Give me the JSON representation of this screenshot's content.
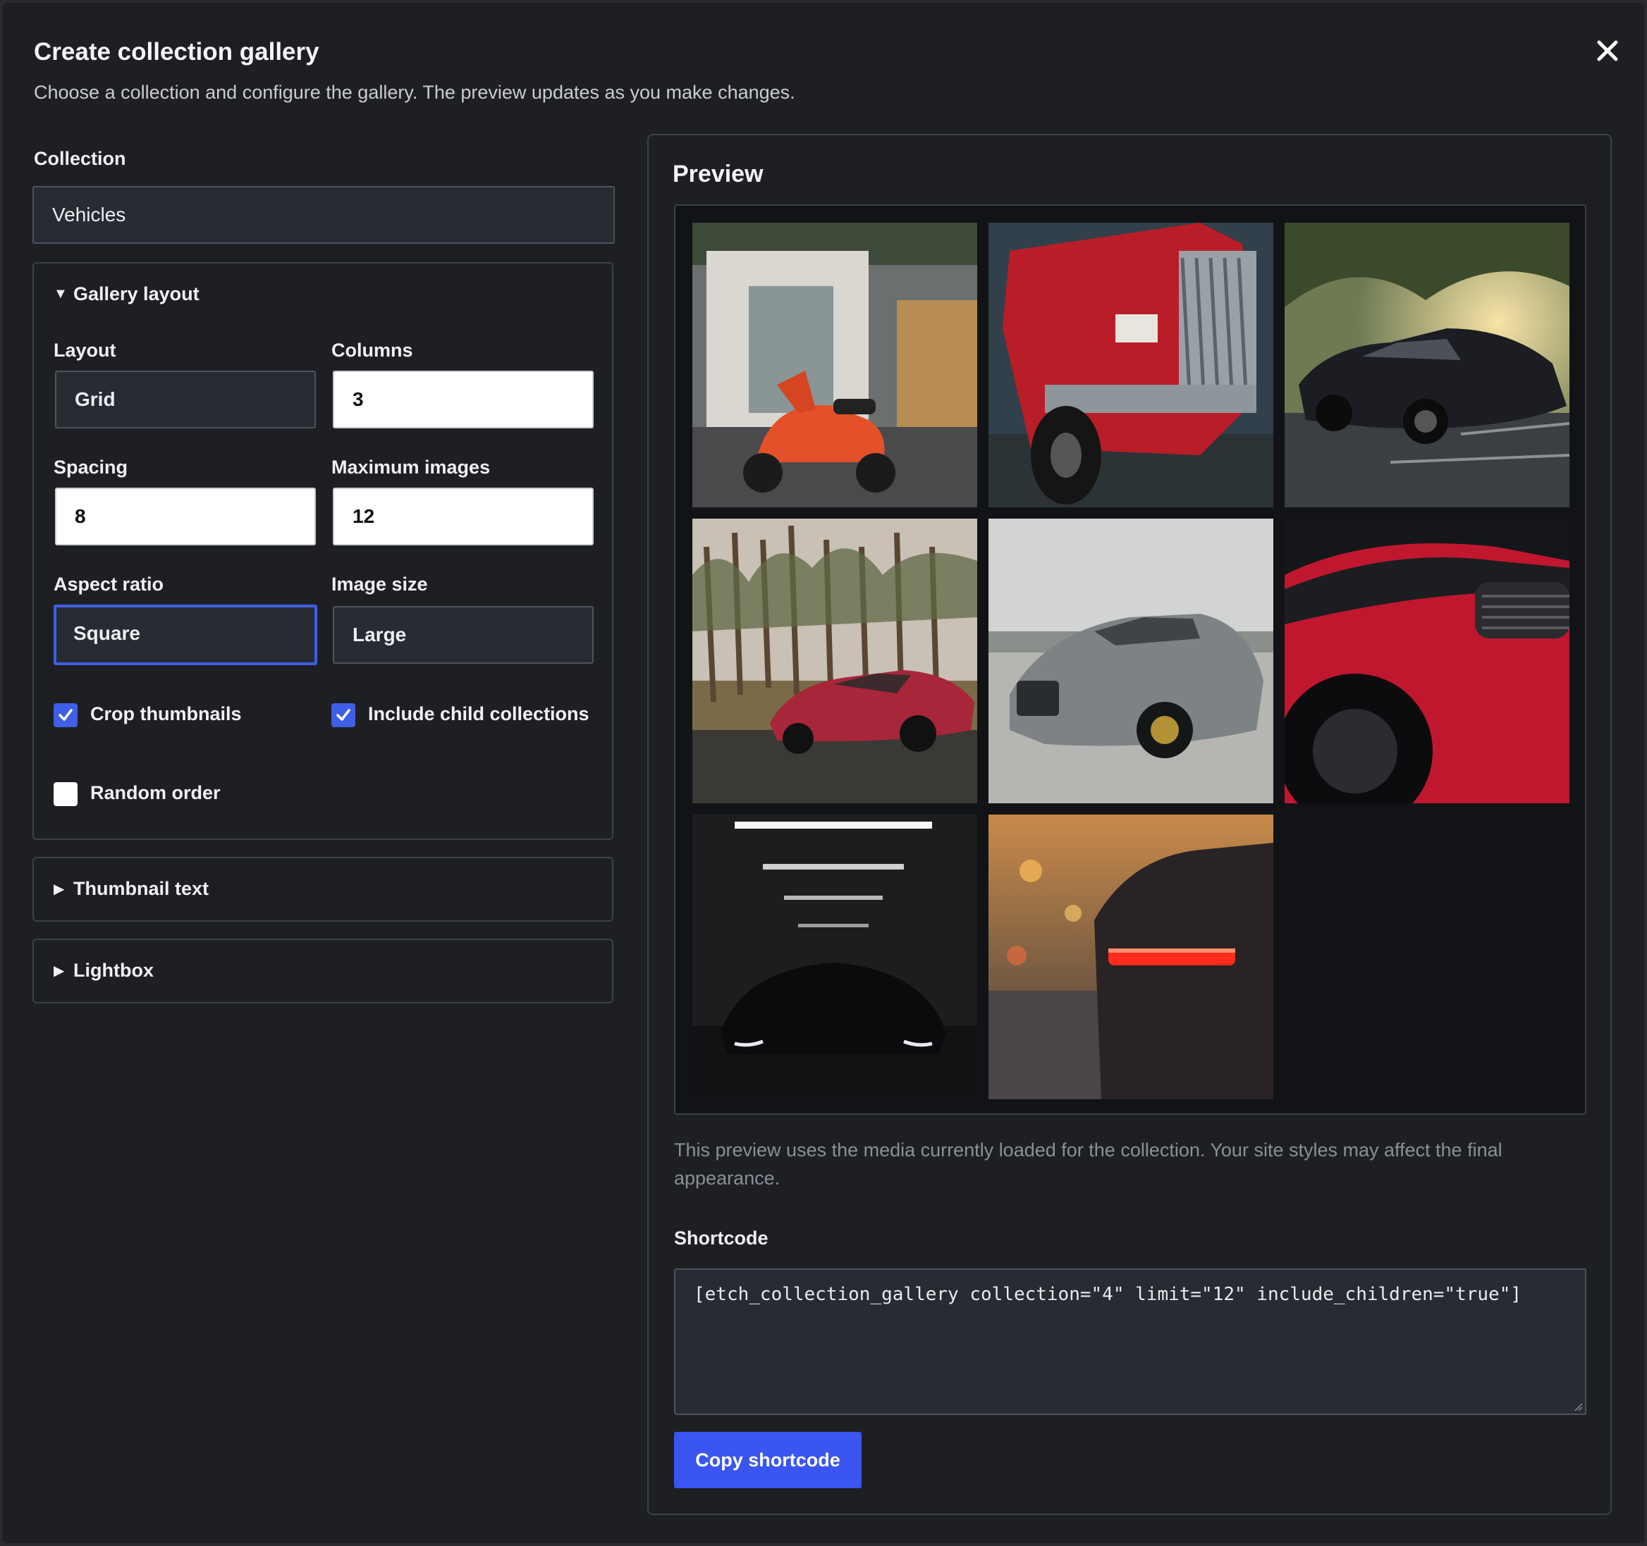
{
  "modal": {
    "title": "Create collection gallery",
    "description": "Choose a collection and configure the gallery. The preview updates as you make changes."
  },
  "collection": {
    "label": "Collection",
    "value": "Vehicles"
  },
  "gallery_layout": {
    "summary": "Gallery layout",
    "expanded": true,
    "layout": {
      "label": "Layout",
      "value": "Grid"
    },
    "columns": {
      "label": "Columns",
      "value": "3"
    },
    "spacing": {
      "label": "Spacing",
      "value": "8"
    },
    "max_images": {
      "label": "Maximum images",
      "value": "12"
    },
    "aspect_ratio": {
      "label": "Aspect ratio",
      "value": "Square"
    },
    "image_size": {
      "label": "Image size",
      "value": "Large"
    },
    "crop_thumbnails": {
      "label": "Crop thumbnails",
      "checked": true
    },
    "include_children": {
      "label": "Include child collections",
      "checked": true
    },
    "random_order": {
      "label": "Random order",
      "checked": false
    }
  },
  "thumbnail_text": {
    "summary": "Thumbnail text",
    "expanded": false
  },
  "lightbox": {
    "summary": "Lightbox",
    "expanded": false
  },
  "preview": {
    "title": "Preview",
    "images": [
      "orange-scooter",
      "red-truck",
      "black-mustang",
      "red-sports-car-forest",
      "silver-amg-gt",
      "red-car-closeup",
      "black-car-garage",
      "red-car-taillights"
    ],
    "note": "This preview uses the media currently loaded for the collection. Your site styles may affect the final appearance."
  },
  "shortcode": {
    "label": "Shortcode",
    "value": "[etch_collection_gallery collection=\"4\" limit=\"12\" include_children=\"true\"]",
    "copy_label": "Copy shortcode"
  },
  "colors": {
    "background": "#1e1f22",
    "accent": "#3f5fe6",
    "input_bg": "#272b32"
  }
}
